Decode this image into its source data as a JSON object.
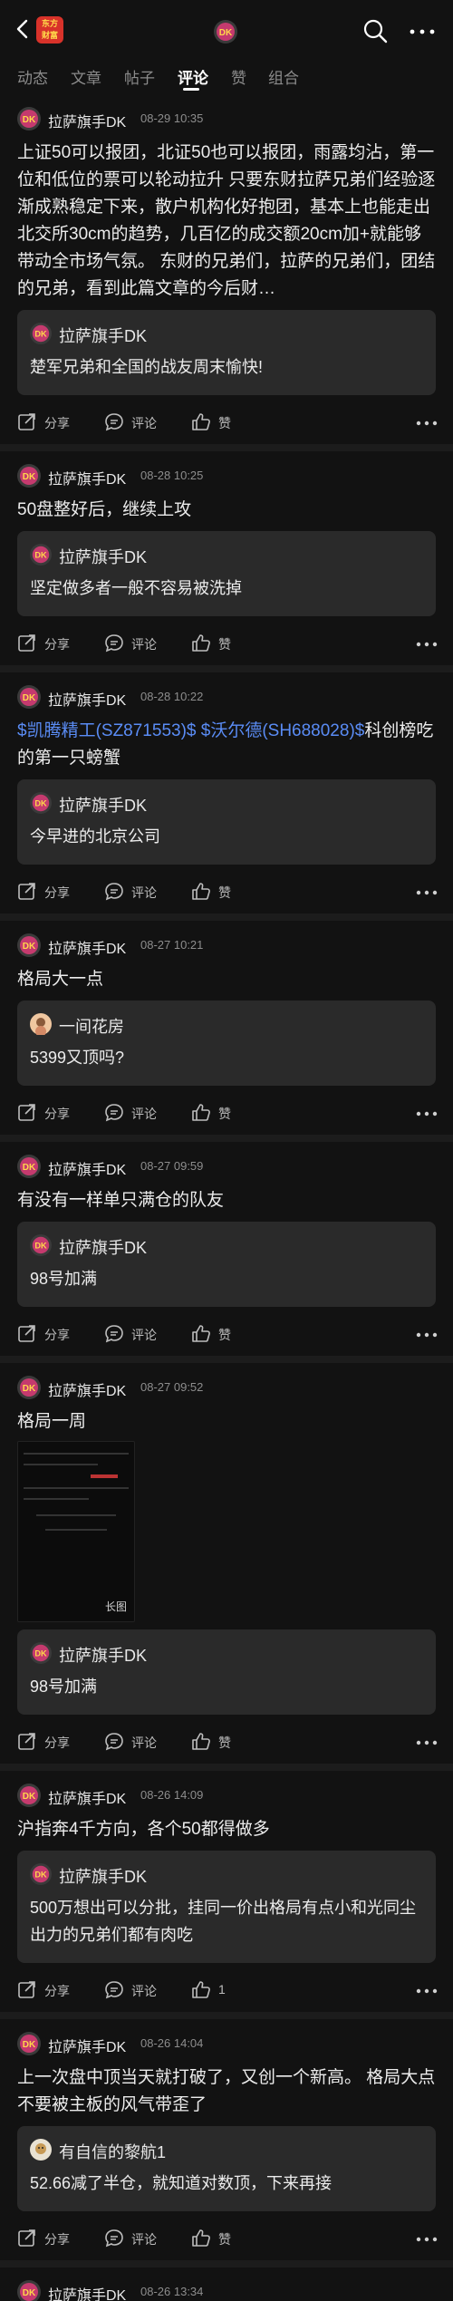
{
  "header": {
    "app_logo_line1": "东方",
    "app_logo_line2": "财富"
  },
  "tabs": [
    {
      "label": "动态"
    },
    {
      "label": "文章"
    },
    {
      "label": "帖子"
    },
    {
      "label": "评论"
    },
    {
      "label": "赞"
    },
    {
      "label": "组合"
    }
  ],
  "actions": {
    "share": "分享",
    "comment": "评论",
    "like": "赞"
  },
  "posts": [
    {
      "user": "拉萨旗手DK",
      "date": "08-29 10:35",
      "body": "上证50可以报团，北证50也可以报团，雨露均沾，第一位和低位的票可以轮动拉升 只要东财拉萨兄弟们经验逐渐成熟稳定下来，散户机构化好抱团，基本上也能走出北交所30cm的趋势，几百亿的成交额20cm加+就能够带动全市场气氛。 东财的兄弟们，拉萨的兄弟们，团结的兄弟，看到此篇文章的今后财…",
      "quote_user": "拉萨旗手DK",
      "quote_text": "楚军兄弟和全国的战友周末愉快!",
      "like": "赞"
    },
    {
      "user": "拉萨旗手DK",
      "date": "08-28 10:25",
      "body": "50盘整好后，继续上攻",
      "quote_user": "拉萨旗手DK",
      "quote_text": "坚定做多者一般不容易被洗掉",
      "like": "赞"
    },
    {
      "user": "拉萨旗手DK",
      "date": "08-28 10:22",
      "body_stock1": "$凯腾精工(SZ871553)$",
      "body_stock2": "$沃尔德(SH688028)$",
      "body_tail": "科创榜吃的第一只螃蟹",
      "quote_user": "拉萨旗手DK",
      "quote_text": "今早进的北京公司",
      "like": "赞"
    },
    {
      "user": "拉萨旗手DK",
      "date": "08-27 10:21",
      "body": "格局大一点",
      "quote_user": "一间花房",
      "quote_text": "5399又顶吗?",
      "like": "赞"
    },
    {
      "user": "拉萨旗手DK",
      "date": "08-27 09:59",
      "body": "有没有一样单只满仓的队友",
      "quote_user": "拉萨旗手DK",
      "quote_text": "98号加满",
      "like": "赞"
    },
    {
      "user": "拉萨旗手DK",
      "date": "08-27 09:52",
      "body": "格局一周",
      "image_label": "长图",
      "quote_user": "拉萨旗手DK",
      "quote_text": "98号加满",
      "like": "赞"
    },
    {
      "user": "拉萨旗手DK",
      "date": "08-26 14:09",
      "body": "沪指奔4千方向，各个50都得做多",
      "quote_user": "拉萨旗手DK",
      "quote_text": "500万想出可以分批，挂同一价出格局有点小和光同尘出力的兄弟们都有肉吃",
      "like": "1"
    },
    {
      "user": "拉萨旗手DK",
      "date": "08-26 14:04",
      "body": "上一次盘中顶当天就打破了，又创一个新高。 格局大点不要被主板的风气带歪了",
      "quote_user": "有自信的黎航1",
      "quote_text": "52.66减了半仓，就知道对数顶，下来再接",
      "like": "赞"
    },
    {
      "user": "拉萨旗手DK",
      "date": "08-26 13:34"
    }
  ]
}
